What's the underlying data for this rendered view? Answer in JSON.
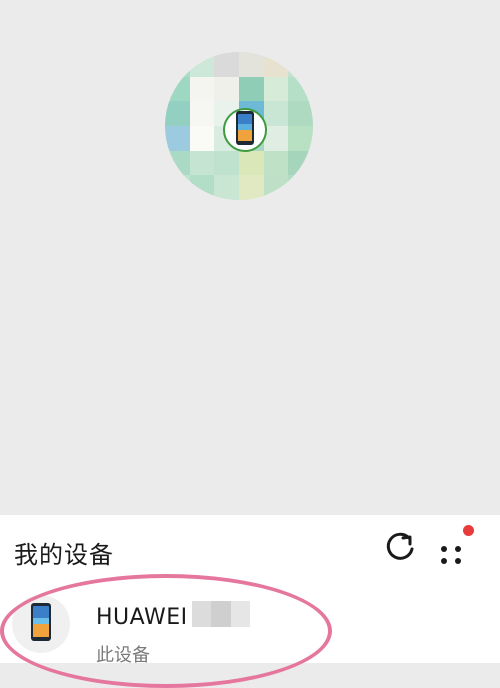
{
  "sheet": {
    "title": "我的设备",
    "refresh_icon": "refresh-icon",
    "more_icon": "more-dots-icon",
    "notification_color": "#e83b3b"
  },
  "device": {
    "name": "HUAWEI",
    "subtitle": "此设备",
    "icon": "phone-icon"
  },
  "avatar": {
    "icon": "phone-icon",
    "ring_color": "#3f9b3f"
  },
  "annotation": {
    "highlight_color": "#e5779e"
  }
}
